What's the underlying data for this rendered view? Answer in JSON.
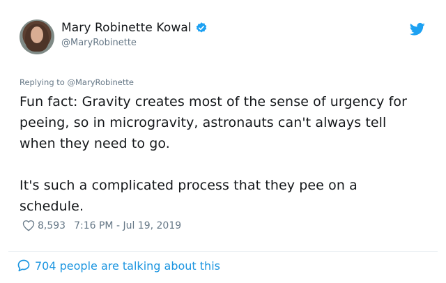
{
  "author": {
    "display_name": "Mary Robinette Kowal",
    "handle": "@MaryRobinette",
    "verified": true
  },
  "reply": {
    "prefix": "Replying to ",
    "mention": "@MaryRobinette"
  },
  "tweet": {
    "paragraphs": [
      "Fun fact: Gravity creates most of the sense of urgency for peeing, so in microgravity, astronauts can't always tell when they need to go.",
      "It's such a complicated process that they pee on a schedule."
    ]
  },
  "meta": {
    "likes": "8,593",
    "timestamp": "7:16 PM - Jul 19, 2019"
  },
  "footer": {
    "talking": "704 people are talking about this"
  },
  "colors": {
    "accent": "#1da1f2",
    "link": "#1b95e0",
    "muted": "#657786",
    "text": "#14171a"
  },
  "icons": [
    "verified-badge-icon",
    "twitter-bird-icon",
    "heart-icon",
    "speech-bubble-icon"
  ]
}
